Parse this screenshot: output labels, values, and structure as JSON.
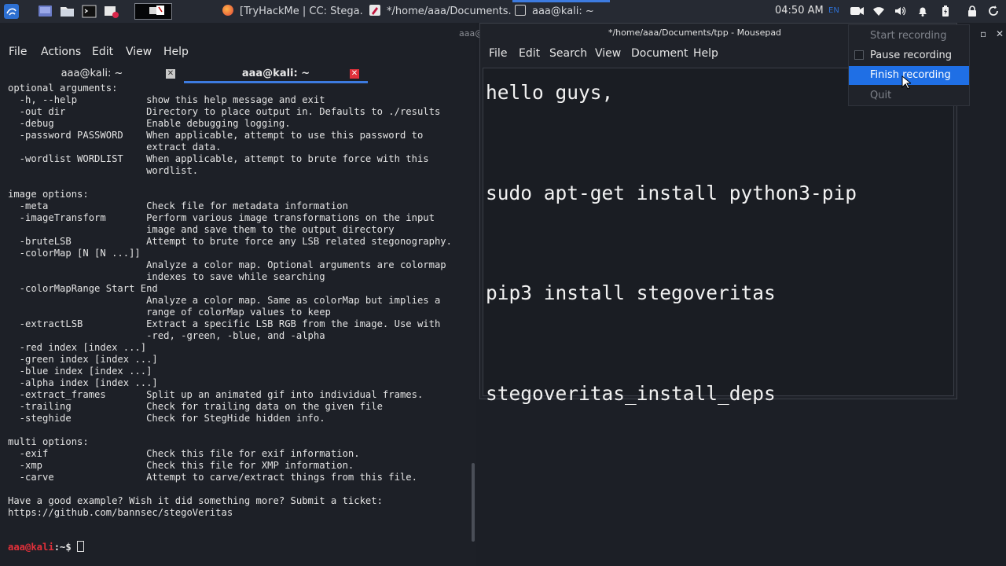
{
  "taskbar": {
    "tasks": [
      {
        "label": "[TryHackMe | CC: Stega..."
      },
      {
        "label": "*/home/aaa/Documents..."
      },
      {
        "label": "aaa@kali: ~"
      }
    ],
    "clock": "04:50 AM",
    "lang": "EN"
  },
  "terminal": {
    "title_partial": "aaa@",
    "menu": [
      "File",
      "Actions",
      "Edit",
      "View",
      "Help"
    ],
    "tabs": [
      {
        "label": "aaa@kali: ~"
      },
      {
        "label": "aaa@kali: ~"
      }
    ],
    "output": [
      "optional arguments:",
      "  -h, --help            show this help message and exit",
      "  -out dir              Directory to place output in. Defaults to ./results",
      "  -debug                Enable debugging logging.",
      "  -password PASSWORD    When applicable, attempt to use this password to",
      "                        extract data.",
      "  -wordlist WORDLIST    When applicable, attempt to brute force with this",
      "                        wordlist.",
      "",
      "image options:",
      "  -meta                 Check file for metadata information",
      "  -imageTransform       Perform various image transformations on the input",
      "                        image and save them to the output directory",
      "  -bruteLSB             Attempt to brute force any LSB related stegonography.",
      "  -colorMap [N [N ...]]",
      "                        Analyze a color map. Optional arguments are colormap",
      "                        indexes to save while searching",
      "  -colorMapRange Start End",
      "                        Analyze a color map. Same as colorMap but implies a",
      "                        range of colorMap values to keep",
      "  -extractLSB           Extract a specific LSB RGB from the image. Use with",
      "                        -red, -green, -blue, and -alpha",
      "  -red index [index ...]",
      "  -green index [index ...]",
      "  -blue index [index ...]",
      "  -alpha index [index ...]",
      "  -extract_frames       Split up an animated gif into individual frames.",
      "  -trailing             Check for trailing data on the given file",
      "  -steghide             Check for StegHide hidden info.",
      "",
      "multi options:",
      "  -exif                 Check this file for exif information.",
      "  -xmp                  Check this file for XMP information.",
      "  -carve                Attempt to carve/extract things from this file.",
      "",
      "Have a good example? Wish it did something more? Submit a ticket:",
      "https://github.com/bannsec/stegoVeritas"
    ],
    "prompt": {
      "userhost": "aaa@kali",
      "path": ":~$ "
    }
  },
  "editor": {
    "title": "*/home/aaa/Documents/tpp - Mousepad",
    "menu": [
      "File",
      "Edit",
      "Search",
      "View",
      "Document",
      "Help"
    ],
    "content": "hello guys,\n\nsudo apt-get install python3-pip\n\npip3 install stegoveritas\n\nstegoveritas_install_deps"
  },
  "recording_menu": {
    "items": [
      {
        "label": "Start recording",
        "state": "disabled"
      },
      {
        "label": "Pause recording",
        "state": "checkbox"
      },
      {
        "label": "Finish recording",
        "state": "highlighted"
      },
      {
        "label": "Quit",
        "state": "disabled"
      }
    ]
  },
  "colors": {
    "accent": "#3d7be0",
    "highlight": "#1f6fe5",
    "prompt_red": "#e0303a",
    "panel": "#262a33",
    "terminal_bg": "#1d2027"
  }
}
